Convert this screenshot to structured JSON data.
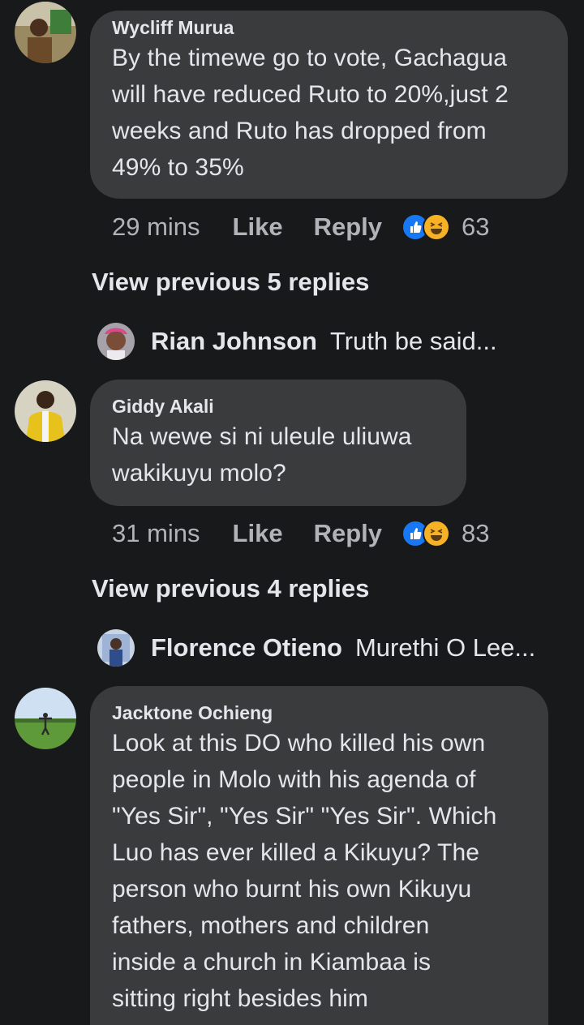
{
  "colors": {
    "background": "#18191a",
    "bubble": "#3a3b3c",
    "text": "#e4e6eb",
    "secondary": "#b0b3b8",
    "like": "#1877f2",
    "haha": "#f7b125"
  },
  "comments": [
    {
      "author": "Wycliff Murua",
      "lines": [
        "By the timewe go to vote, Gachagua",
        "will have reduced Ruto to 20%,just 2",
        "weeks and Ruto has dropped from",
        "49% to 35%"
      ],
      "time": "29 mins",
      "like_label": "Like",
      "reply_label": "Reply",
      "reaction_icons": [
        "like-icon",
        "haha-icon"
      ],
      "reaction_count": "63",
      "view_previous": "View previous 5 replies",
      "latest_reply": {
        "author": "Rian Johnson",
        "text": "Truth be said..."
      }
    },
    {
      "author": "Giddy Akali",
      "lines": [
        "Na wewe si ni uleule uliuwa",
        "wakikuyu molo?"
      ],
      "time": "31 mins",
      "like_label": "Like",
      "reply_label": "Reply",
      "reaction_icons": [
        "like-icon",
        "haha-icon"
      ],
      "reaction_count": "83",
      "view_previous": "View previous 4 replies",
      "latest_reply": {
        "author": "Florence Otieno",
        "text": "Murethi O Lee..."
      }
    },
    {
      "author": "Jacktone Ochieng",
      "lines": [
        "Look at this DO who killed his own",
        "people in Molo with his agenda of",
        "\"Yes Sir\", \"Yes Sir\" \"Yes Sir\". Which",
        "Luo has ever killed a Kikuyu? The",
        "person who burnt his own Kikuyu",
        "fathers, mothers and children",
        "inside a church in Kiambaa is",
        "sitting right besides him"
      ]
    }
  ]
}
